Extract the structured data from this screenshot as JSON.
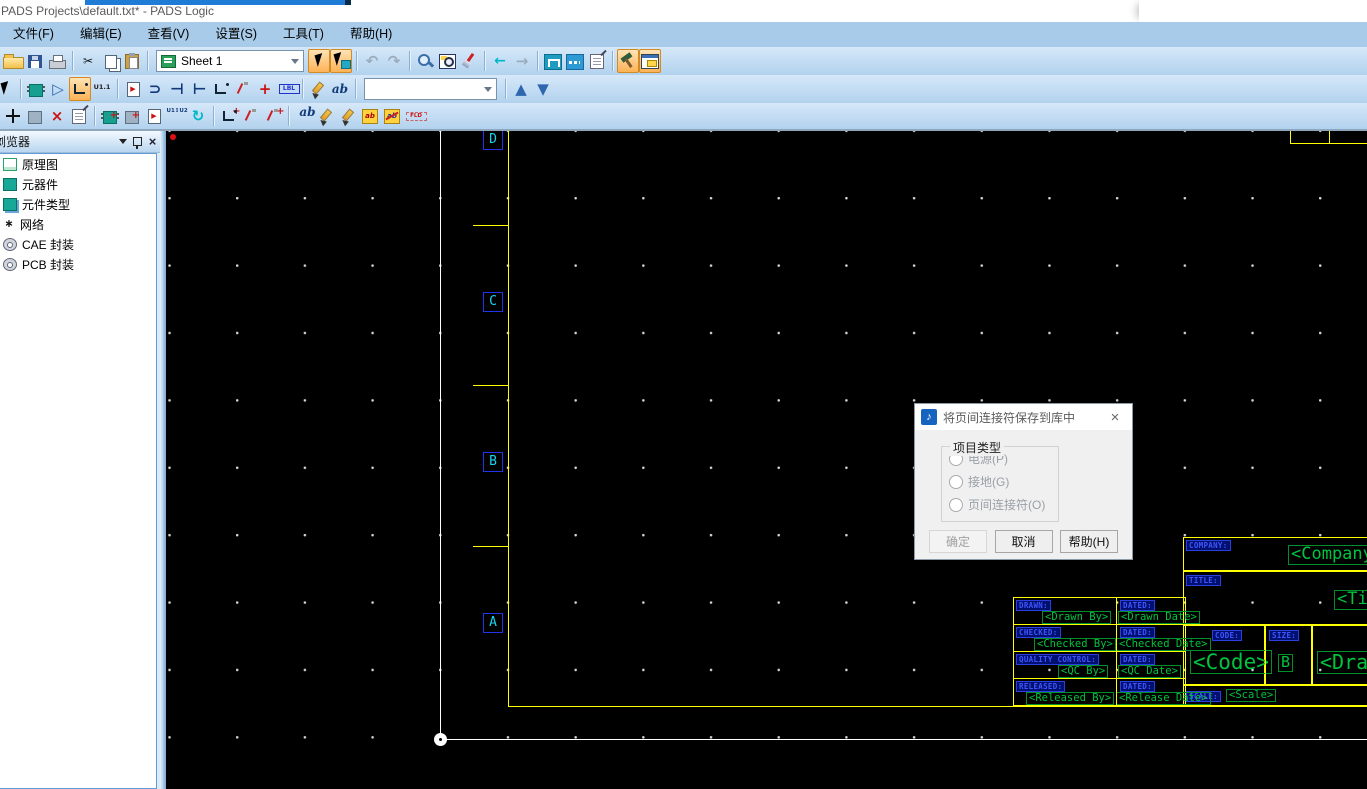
{
  "window": {
    "title": "PADS Projects\\default.txt* - PADS Logic"
  },
  "menu": {
    "items": [
      {
        "label": "文件(F)",
        "n": "menu-file"
      },
      {
        "label": "编辑(E)",
        "n": "menu-edit"
      },
      {
        "label": "查看(V)",
        "n": "menu-view"
      },
      {
        "label": "设置(S)",
        "n": "menu-setup"
      },
      {
        "label": "工具(T)",
        "n": "menu-tools"
      },
      {
        "label": "帮助(H)",
        "n": "menu-help"
      }
    ]
  },
  "toolbar1": {
    "sheet_value": "Sheet 1",
    "left": [
      {
        "n": "open-button",
        "ia": "true",
        "c": "",
        "i": "ic-folder",
        "g": ""
      },
      {
        "n": "save-button",
        "ia": "true",
        "c": "",
        "i": "ic-floppy",
        "g": ""
      },
      {
        "n": "print-button",
        "ia": "true",
        "c": "",
        "i": "ic-printer",
        "g": ""
      },
      {
        "n": "separator",
        "ia": "false",
        "c": "tbsep",
        "i": "",
        "g": ""
      },
      {
        "n": "cut-button",
        "ia": "true",
        "c": "",
        "i": "",
        "g": "✂"
      },
      {
        "n": "copy-button",
        "ia": "true",
        "c": "",
        "i": "ic-copy",
        "g": ""
      },
      {
        "n": "paste-button",
        "ia": "true",
        "c": "",
        "i": "ic-paste",
        "g": ""
      },
      {
        "n": "separator",
        "ia": "false",
        "c": "tbsep",
        "i": "",
        "g": ""
      }
    ],
    "right": [
      {
        "n": "selection-mode-button",
        "ia": "true",
        "c": "hl",
        "i": "ic-pointer",
        "g": ""
      },
      {
        "n": "connection-select-button",
        "ia": "true",
        "c": "hl",
        "i": "ic-pointer2",
        "g": ""
      },
      {
        "n": "separator",
        "ia": "false",
        "c": "tbsep",
        "i": "",
        "g": ""
      },
      {
        "n": "undo-button",
        "ia": "true",
        "c": "",
        "i": "gray big",
        "g": "↶"
      },
      {
        "n": "redo-button",
        "ia": "true",
        "c": "",
        "i": "gray big",
        "g": "↷"
      },
      {
        "n": "separator",
        "ia": "false",
        "c": "tbsep",
        "i": "",
        "g": ""
      },
      {
        "n": "zoom-button",
        "ia": "true",
        "c": "",
        "i": "ic-mag",
        "g": ""
      },
      {
        "n": "board-view-button",
        "ia": "true",
        "c": "",
        "i": "ic-magbox",
        "g": ""
      },
      {
        "n": "redraw-button",
        "ia": "true",
        "c": "",
        "i": "ic-brush",
        "g": ""
      },
      {
        "n": "separator",
        "ia": "false",
        "c": "tbsep",
        "i": "",
        "g": ""
      },
      {
        "n": "previous-sheet-button",
        "ia": "true",
        "c": "",
        "i": "cyan",
        "g": "←"
      },
      {
        "n": "next-sheet-button",
        "ia": "true",
        "c": "",
        "i": "gray big",
        "g": "→"
      },
      {
        "n": "separator",
        "ia": "false",
        "c": "tbsep",
        "i": "",
        "g": ""
      },
      {
        "n": "add-connection-button",
        "ia": "true",
        "c": "",
        "i": "ic-net",
        "g": ""
      },
      {
        "n": "route-mode-button",
        "ia": "true",
        "c": "",
        "i": "ic-net2",
        "g": ""
      },
      {
        "n": "properties-button",
        "ia": "true",
        "c": "",
        "i": "ic-props",
        "g": ""
      },
      {
        "n": "separator",
        "ia": "false",
        "c": "tbsep",
        "i": "",
        "g": ""
      },
      {
        "n": "pads-router-button",
        "ia": "true",
        "c": "hl",
        "i": "ic-hammer",
        "g": ""
      },
      {
        "n": "pads-layout-button",
        "ia": "true",
        "c": "hl",
        "i": "ic-window",
        "g": ""
      }
    ]
  },
  "toolbar2": {
    "combo_value": "",
    "left": [
      {
        "n": "select-pointer-button",
        "ia": "true",
        "c": "cutoff",
        "i": "ic-pointer",
        "g": ""
      },
      {
        "n": "separator",
        "ia": "false",
        "c": "tbsep",
        "i": "",
        "g": ""
      },
      {
        "n": "add-part-button",
        "ia": "true",
        "c": "",
        "i": "ic-chip",
        "g": ""
      },
      {
        "n": "add-gate-button",
        "ia": "true",
        "c": "",
        "i": "blue big",
        "g": "▷"
      },
      {
        "n": "add-wire-button",
        "ia": "true",
        "c": "hl",
        "i": "ic-step",
        "g": ""
      },
      {
        "n": "u11-pin-button",
        "ia": "true",
        "c": "",
        "i": "u11",
        "g": "U1.1"
      },
      {
        "n": "separator",
        "ia": "false",
        "c": "tbsep",
        "i": "",
        "g": ""
      },
      {
        "n": "page-connector-button",
        "ia": "true",
        "c": "",
        "i": "ic-doc",
        "g": "▶"
      },
      {
        "n": "gate-symbol-button",
        "ia": "true",
        "c": "",
        "i": "navy big",
        "g": "⊃"
      },
      {
        "n": "pin-left-button",
        "ia": "true",
        "c": "",
        "i": "navy big",
        "g": "⊣"
      },
      {
        "n": "pin-right-button",
        "ia": "true",
        "c": "",
        "i": "navy big flip",
        "g": "⊣"
      },
      {
        "n": "wire-corner-button",
        "ia": "true",
        "c": "",
        "i": "ic-step",
        "g": ""
      },
      {
        "n": "angled-wire-button",
        "ia": "true",
        "c": "",
        "i": "ic-stepred",
        "g": ""
      },
      {
        "n": "junction-button",
        "ia": "true",
        "c": "",
        "i": "red big",
        "g": "+"
      },
      {
        "n": "label-button",
        "ia": "true",
        "c": "",
        "i": "lbl",
        "g": "LBL"
      },
      {
        "n": "separator",
        "ia": "false",
        "c": "tbsep",
        "i": "",
        "g": ""
      },
      {
        "n": "field-label-button",
        "ia": "true",
        "c": "",
        "i": "ic-pencil",
        "g": ""
      },
      {
        "n": "text-button",
        "ia": "true",
        "c": "",
        "i": "navy ital",
        "g": "ab"
      },
      {
        "n": "separator",
        "ia": "false",
        "c": "tbsep",
        "i": "",
        "g": ""
      }
    ],
    "right": [
      {
        "n": "separator",
        "ia": "false",
        "c": "tbsep",
        "i": "",
        "g": ""
      },
      {
        "n": "move-up-button",
        "ia": "true",
        "c": "",
        "i": "blue big",
        "g": "▲"
      },
      {
        "n": "move-down-button",
        "ia": "true",
        "c": "",
        "i": "blue big",
        "g": "▼"
      }
    ]
  },
  "toolbar3": {
    "items": [
      {
        "n": "move-button",
        "ia": "true",
        "c": "",
        "i": "ic-move",
        "g": ""
      },
      {
        "n": "swap-gate-button",
        "ia": "true",
        "c": "",
        "i": "ic-chipgray",
        "g": ""
      },
      {
        "n": "delete-button",
        "ia": "true",
        "c": "",
        "i": "red big",
        "g": "×"
      },
      {
        "n": "properties-button-2",
        "ia": "true",
        "c": "",
        "i": "ic-props",
        "g": ""
      },
      {
        "n": "separator",
        "ia": "false",
        "c": "tbsep",
        "i": "",
        "g": ""
      },
      {
        "n": "add-gate-b-button",
        "ia": "true",
        "c": "",
        "i": "ic-chip ov",
        "g": "+"
      },
      {
        "n": "copy-gate-button",
        "ia": "true",
        "c": "",
        "i": "ic-chipgray ov",
        "g": "+"
      },
      {
        "n": "new-sheet-button",
        "ia": "true",
        "c": "",
        "i": "ic-doc",
        "g": "▶"
      },
      {
        "n": "swap-reference-button",
        "ia": "true",
        "c": "",
        "i": "u12 navy",
        "g": "U1↕U2"
      },
      {
        "n": "rotate-button",
        "ia": "true",
        "c": "",
        "i": "cyan big",
        "g": "↻"
      },
      {
        "n": "separator",
        "ia": "false",
        "c": "tbsep",
        "i": "",
        "g": ""
      },
      {
        "n": "add-pin-button",
        "ia": "true",
        "c": "",
        "i": "ic-step ov",
        "g": "+"
      },
      {
        "n": "swap-pin-button",
        "ia": "true",
        "c": "",
        "i": "ic-stepred",
        "g": ""
      },
      {
        "n": "renumber-pin-button",
        "ia": "true",
        "c": "",
        "i": "ic-stepred ov",
        "g": "+"
      },
      {
        "n": "separator",
        "ia": "false",
        "c": "tbsep",
        "i": "",
        "g": ""
      },
      {
        "n": "change-text-button",
        "ia": "true",
        "c": "",
        "i": "navy ital ov",
        "g": "ab"
      },
      {
        "n": "edit-text-button",
        "ia": "true",
        "c": "",
        "i": "ic-pencil",
        "g": ""
      },
      {
        "n": "edit-field-button",
        "ia": "true",
        "c": "",
        "i": "ic-pencil",
        "g": ""
      },
      {
        "n": "db-text-button",
        "ia": "true",
        "c": "",
        "i": "ic-db",
        "g": "ab"
      },
      {
        "n": "db-edit-button",
        "ia": "true",
        "c": "",
        "i": "ic-db2",
        "g": "ab"
      },
      {
        "n": "fld-button",
        "ia": "true",
        "c": "",
        "i": "fld",
        "g": "FLD"
      }
    ]
  },
  "browser": {
    "title": "浏览器",
    "items": [
      {
        "label": "原理图",
        "n": "browser-item-schematic",
        "icon": "schematic-icon",
        "i": "bm-sheet",
        "g": ""
      },
      {
        "label": "元器件",
        "n": "browser-item-components",
        "icon": "component-icon",
        "i": "bm-chip",
        "g": ""
      },
      {
        "label": "元件类型",
        "n": "browser-item-part-types",
        "icon": "part-type-icon",
        "i": "bm-chip2",
        "g": ""
      },
      {
        "label": "网络",
        "n": "browser-item-nets",
        "icon": "net-icon",
        "i": "bm-net",
        "g": "∗"
      },
      {
        "label": "CAE 封装",
        "n": "browser-item-cae-decals",
        "icon": "cae-decal-icon",
        "i": "bm-gear",
        "g": ""
      },
      {
        "label": "PCB 封装",
        "n": "browser-item-pcb-decals",
        "icon": "pcb-decal-icon",
        "i": "bm-gear",
        "g": ""
      }
    ]
  },
  "canvas": {
    "row_labels": [
      "D",
      "C",
      "B",
      "A"
    ]
  },
  "titleblock": {
    "company_label": "COMPANY:",
    "company_value": "<Company",
    "title_label": "TITLE:",
    "title_value": "<Tit",
    "drawn_label": "DRAWN:",
    "drawn_value": "<Drawn By>",
    "dated1_label": "DATED:",
    "drawn_date_value": "<Drawn Date>",
    "checked_label": "CHECKED:",
    "checked_value": "<Checked By>",
    "dated2_label": "DATED:",
    "checked_date_value": "<Checked Date>",
    "qc_label": "QUALITY CONTROL:",
    "qc_value": "<QC By>",
    "dated3_label": "DATED:",
    "qc_date_value": "<QC Date>",
    "released_label": "RELEASED:",
    "released_value": "<Released By>",
    "dated4_label": "DATED:",
    "release_date_value": "<Release Date>",
    "code_label": "CODE:",
    "code_value": "<Code>",
    "size_label": "SIZE:",
    "size_value": "B",
    "drawing_value": "<Drawi",
    "scale_label": "SCALE:",
    "scale_value": "<Scale>"
  },
  "dialog": {
    "title": "将页间连接符保存到库中",
    "close": "×",
    "icon_glyph": "♪",
    "group_label": "项目类型",
    "options": [
      {
        "label": "电源(P)",
        "n": "radio-power"
      },
      {
        "label": "接地(G)",
        "n": "radio-ground"
      },
      {
        "label": "页间连接符(O)",
        "n": "radio-offpage"
      }
    ],
    "ok": "确定",
    "cancel": "取消",
    "help": "帮助(H)"
  },
  "colors": {
    "toolbar_highlight": "#fdb256",
    "sheet_border": "#ffff00",
    "value_green": "#00c43e",
    "label_blue": "#4055ff",
    "row_letter_cyan": "#17d3f2"
  }
}
